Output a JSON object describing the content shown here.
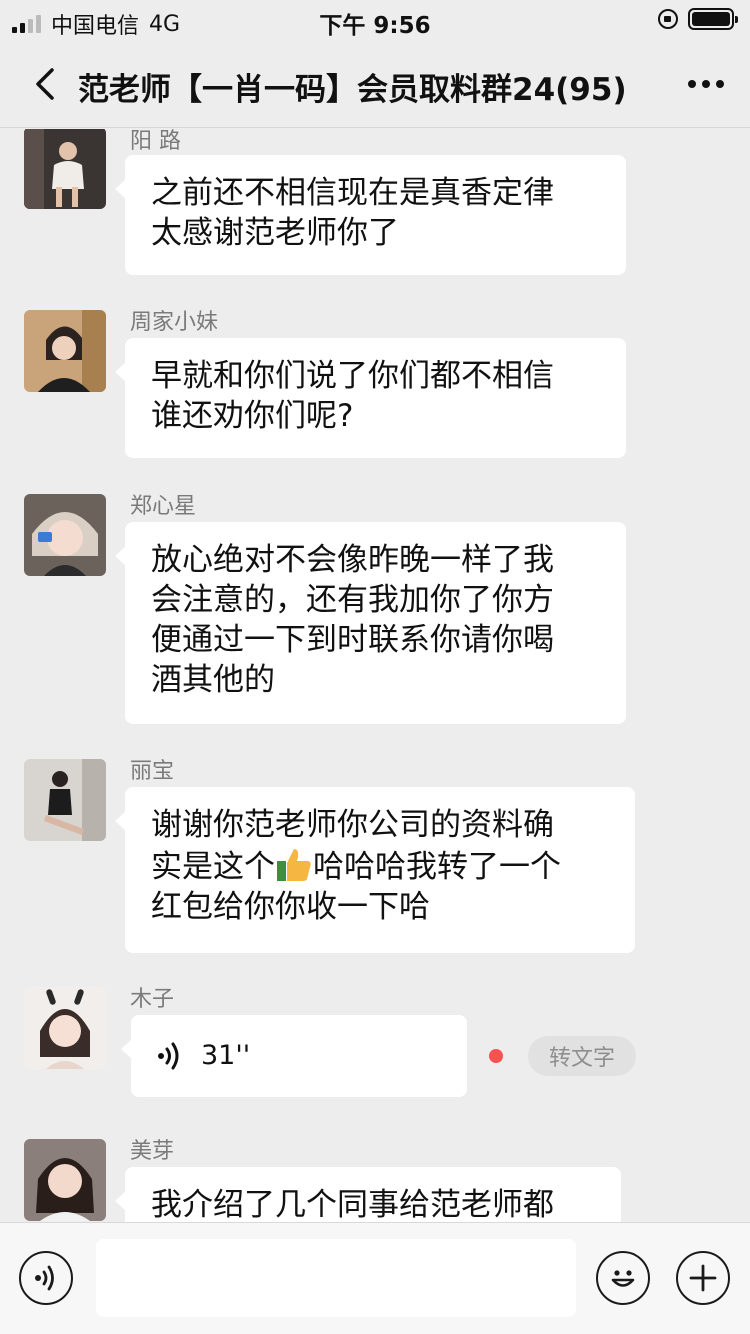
{
  "status_bar": {
    "carrier": "中国电信",
    "network": "4G",
    "time": "下午 9:56",
    "icons": [
      "signal-icon",
      "rotation-lock-icon",
      "battery-icon"
    ]
  },
  "header": {
    "title": "范老师【一肖一码】会员取料群24(95)",
    "back_icon": "chevron-left-icon",
    "more_icon": "more-dots-icon"
  },
  "messages": [
    {
      "sender": "阳 路",
      "type": "text",
      "text": "之前还不相信现在是真香定律\n太感谢范老师你了"
    },
    {
      "sender": "周家小妹",
      "type": "text",
      "text": "早就和你们说了你们都不相信\n谁还劝你们呢?"
    },
    {
      "sender": "郑心星",
      "type": "text",
      "text": "放心绝对不会像昨晚一样了我\n会注意的，还有我加你了你方\n便通过一下到时联系你请你喝\n酒其他的"
    },
    {
      "sender": "丽宝",
      "type": "text",
      "text_before_emoji": "谢谢你范老师你公司的资料确\n实是这个",
      "emoji": "thumbs-up-emoji",
      "text_after_emoji": "哈哈哈我转了一个\n红包给你你收一下哈"
    },
    {
      "sender": "木子",
      "type": "voice",
      "duration": "31''",
      "convert_label": "转文字",
      "unread": true
    },
    {
      "sender": "美芽",
      "type": "text",
      "text": "我介绍了几个同事给范老师都"
    }
  ],
  "input_bar": {
    "placeholder": "",
    "voice_icon": "voice-input-icon",
    "emoji_icon": "emoji-icon",
    "plus_icon": "plus-icon"
  },
  "colors": {
    "background": "#ededed",
    "bubble": "#ffffff",
    "unread_dot": "#fa5151",
    "toolbar": "#f7f7f7"
  }
}
